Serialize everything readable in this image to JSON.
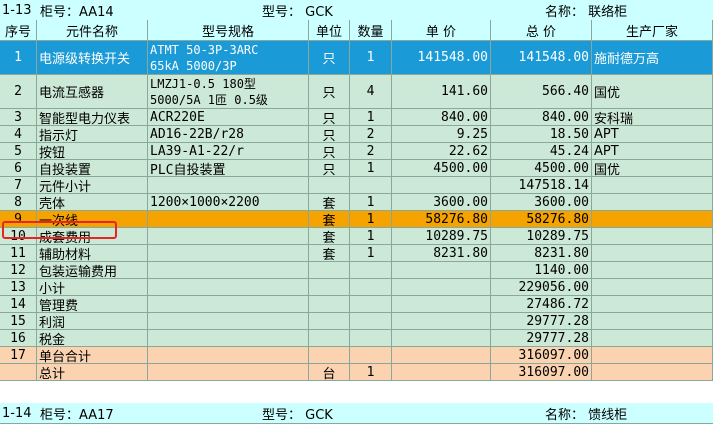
{
  "top_header": {
    "code": "1-13",
    "cabinet": "柜号：AA14",
    "model": "型号：  GCK",
    "name": "名称：  联络柜"
  },
  "columns": [
    "序号",
    "元件名称",
    "型号规格",
    "单位",
    "数量",
    "单 价",
    "总 价",
    "生产厂家"
  ],
  "rows": [
    {
      "no": "1",
      "name": "电源级转换开关",
      "spec": [
        "ATMT  50-3P-3ARC",
        "65kA  5000/3P"
      ],
      "unit": "只",
      "qty": "1",
      "price": "141548.00",
      "total": "141548.00",
      "maker": "施耐德万高"
    },
    {
      "no": "2",
      "name": "电流互感器",
      "spec": [
        "LMZJ1-0.5  180型",
        "5000/5A  1匝  0.5级"
      ],
      "unit": "只",
      "qty": "4",
      "price": "141.60",
      "total": "566.40",
      "maker": "国优"
    },
    {
      "no": "3",
      "name": "智能型电力仪表",
      "spec": [
        "ACR220E"
      ],
      "unit": "只",
      "qty": "1",
      "price": "840.00",
      "total": "840.00",
      "maker": "安科瑞"
    },
    {
      "no": "4",
      "name": "指示灯",
      "spec": [
        "AD16-22B/r28"
      ],
      "unit": "只",
      "qty": "2",
      "price": "9.25",
      "total": "18.50",
      "maker": "APT"
    },
    {
      "no": "5",
      "name": "按钮",
      "spec": [
        "LA39-A1-22/r"
      ],
      "unit": "只",
      "qty": "2",
      "price": "22.62",
      "total": "45.24",
      "maker": "APT"
    },
    {
      "no": "6",
      "name": "自投装置",
      "spec": [
        "PLC自投装置"
      ],
      "unit": "只",
      "qty": "1",
      "price": "4500.00",
      "total": "4500.00",
      "maker": "国优"
    },
    {
      "no": "7",
      "name": "元件小计",
      "spec": [
        ""
      ],
      "unit": "",
      "qty": "",
      "price": "",
      "total": "147518.14",
      "maker": ""
    },
    {
      "no": "8",
      "name": "壳体",
      "spec": [
        "1200×1000×2200"
      ],
      "unit": "套",
      "qty": "1",
      "price": "3600.00",
      "total": "3600.00",
      "maker": ""
    },
    {
      "no": "9",
      "name": "一次线",
      "spec": [
        ""
      ],
      "unit": "套",
      "qty": "1",
      "price": "58276.80",
      "total": "58276.80",
      "maker": ""
    },
    {
      "no": "10",
      "name": "成套费用",
      "spec": [
        ""
      ],
      "unit": "套",
      "qty": "1",
      "price": "10289.75",
      "total": "10289.75",
      "maker": ""
    },
    {
      "no": "11",
      "name": "辅助材料",
      "spec": [
        ""
      ],
      "unit": "套",
      "qty": "1",
      "price": "8231.80",
      "total": "8231.80",
      "maker": ""
    },
    {
      "no": "12",
      "name": "包装运输费用",
      "spec": [
        ""
      ],
      "unit": "",
      "qty": "",
      "price": "",
      "total": "1140.00",
      "maker": ""
    },
    {
      "no": "13",
      "name": "小计",
      "spec": [
        ""
      ],
      "unit": "",
      "qty": "",
      "price": "",
      "total": "229056.00",
      "maker": ""
    },
    {
      "no": "14",
      "name": "管理费",
      "spec": [
        ""
      ],
      "unit": "",
      "qty": "",
      "price": "",
      "total": "27486.72",
      "maker": ""
    },
    {
      "no": "15",
      "name": "利润",
      "spec": [
        ""
      ],
      "unit": "",
      "qty": "",
      "price": "",
      "total": "29777.28",
      "maker": ""
    },
    {
      "no": "16",
      "name": "税金",
      "spec": [
        ""
      ],
      "unit": "",
      "qty": "",
      "price": "",
      "total": "29777.28",
      "maker": ""
    },
    {
      "no": "17",
      "name": "单台合计",
      "spec": [
        ""
      ],
      "unit": "",
      "qty": "",
      "price": "",
      "total": "316097.00",
      "maker": ""
    },
    {
      "no": "",
      "name": "总计",
      "spec": [
        ""
      ],
      "unit": "台",
      "qty": "1",
      "price": "",
      "total": "316097.00",
      "maker": ""
    }
  ],
  "bottom_header": {
    "code": "1-14",
    "cabinet": "柜号：AA17",
    "model": "型号：  GCK",
    "name": "名称：  馈线柜"
  },
  "colors": {
    "header_bar": "#ccffff",
    "green": "#cce8d6",
    "blue": "#1a9ad6",
    "orange": "#f5a300",
    "peach": "#fbd3b0",
    "selection": "#e8251e"
  }
}
